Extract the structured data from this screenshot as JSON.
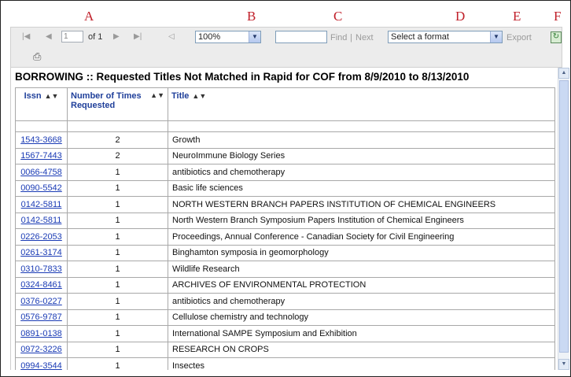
{
  "callouts": [
    "A",
    "B",
    "C",
    "D",
    "E",
    "F"
  ],
  "toolbar": {
    "page_value": "1",
    "page_of": "of 1",
    "zoom": "100%",
    "find_label": "Find",
    "separator": "|",
    "next_label": "Next",
    "format_placeholder": "Select a format",
    "export_label": "Export"
  },
  "report": {
    "title": "BORROWING :: Requested Titles Not Matched in Rapid for COF from 8/9/2010 to 8/13/2010",
    "columns": {
      "issn": "Issn",
      "count": "Number of Times Requested",
      "title": "Title"
    },
    "rows": [
      {
        "issn": "1543-3668",
        "count": "2",
        "title": "Growth"
      },
      {
        "issn": "1567-7443",
        "count": "2",
        "title": "NeuroImmune Biology Series"
      },
      {
        "issn": "0066-4758",
        "count": "1",
        "title": "antibiotics and chemotherapy"
      },
      {
        "issn": "0090-5542",
        "count": "1",
        "title": "Basic life sciences"
      },
      {
        "issn": "0142-5811",
        "count": "1",
        "title": "NORTH WESTERN BRANCH PAPERS INSTITUTION OF CHEMICAL ENGINEERS"
      },
      {
        "issn": "0142-5811",
        "count": "1",
        "title": "North Western Branch Symposium Papers Institution of Chemical Engineers"
      },
      {
        "issn": "0226-2053",
        "count": "1",
        "title": "Proceedings, Annual Conference - Canadian Society for Civil Engineering"
      },
      {
        "issn": "0261-3174",
        "count": "1",
        "title": "Binghamton symposia in geomorphology"
      },
      {
        "issn": "0310-7833",
        "count": "1",
        "title": "Wildlife Research"
      },
      {
        "issn": "0324-8461",
        "count": "1",
        "title": "ARCHIVES OF ENVIRONMENTAL PROTECTION"
      },
      {
        "issn": "0376-0227",
        "count": "1",
        "title": "antibiotics and chemotherapy"
      },
      {
        "issn": "0576-9787",
        "count": "1",
        "title": "Cellulose chemistry and technology"
      },
      {
        "issn": "0891-0138",
        "count": "1",
        "title": "International SAMPE Symposium and Exhibition"
      },
      {
        "issn": "0972-3226",
        "count": "1",
        "title": "RESEARCH ON CROPS"
      },
      {
        "issn": "0994-3544",
        "count": "1",
        "title": "Insectes"
      }
    ]
  },
  "icons": {
    "first_page": "first-page-icon",
    "prev_page": "previous-page-icon",
    "next_page": "next-page-icon",
    "last_page": "last-page-icon",
    "back": "back-icon",
    "refresh": "refresh-icon",
    "print": "print-icon",
    "sort": "sort-icon"
  },
  "colors": {
    "callout": "#c0202a",
    "header_text": "#1f3f9a",
    "link": "#1a3bb5",
    "toolbar_bg": "#ececec"
  }
}
